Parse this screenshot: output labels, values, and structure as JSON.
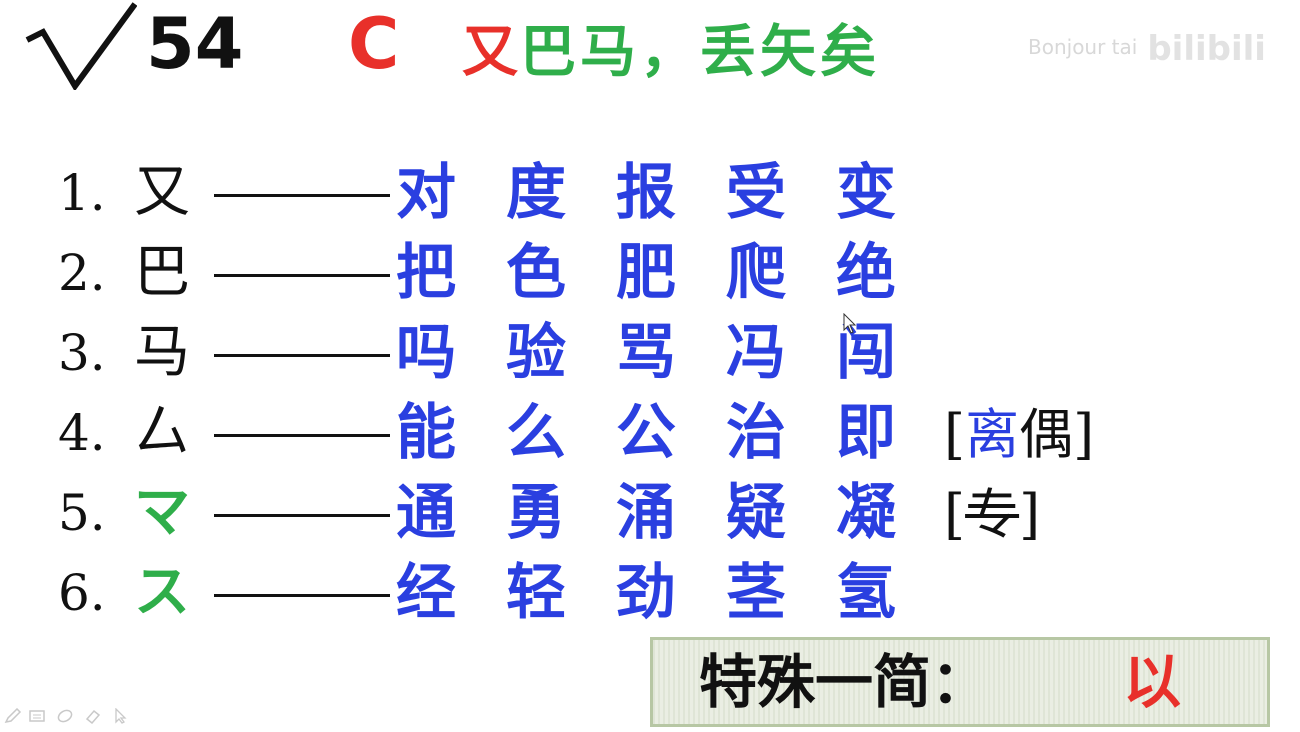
{
  "header": {
    "number": "54",
    "letter": "C",
    "component_red": "又",
    "components_green": "巴马，丢矢矣",
    "watermark_text": "Bonjour tai",
    "watermark_logo": "bilibili"
  },
  "rows": [
    {
      "num": "1.",
      "radical": "又",
      "radical_color": "black",
      "chars": [
        "对",
        "度",
        "报",
        "受",
        "变"
      ]
    },
    {
      "num": "2.",
      "radical": "巴",
      "radical_color": "black",
      "chars": [
        "把",
        "色",
        "肥",
        "爬",
        "绝"
      ]
    },
    {
      "num": "3.",
      "radical": "马",
      "radical_color": "black",
      "chars": [
        "吗",
        "验",
        "骂",
        "冯",
        "闯"
      ]
    },
    {
      "num": "4.",
      "radical": "厶",
      "radical_color": "black",
      "chars": [
        "能",
        "么",
        "公",
        "治",
        "即"
      ],
      "extra": {
        "open": "[",
        "blue": "离",
        "black": "偶",
        "close": "]"
      }
    },
    {
      "num": "5.",
      "radical": "マ",
      "radical_color": "green",
      "chars": [
        "通",
        "勇",
        "涌",
        "疑",
        "凝"
      ],
      "extra": {
        "open": "[",
        "strike": "专",
        "close": "]"
      }
    },
    {
      "num": "6.",
      "radical": "ス",
      "radical_color": "green",
      "chars": [
        "经",
        "轻",
        "劲",
        "茎",
        "氢"
      ]
    }
  ],
  "special": {
    "label": "特殊一简：",
    "value": "以"
  },
  "colors": {
    "blue": "#2a3fe0",
    "red": "#e8302a",
    "green": "#2fae4a"
  },
  "tools": [
    "pen-icon",
    "screen-icon",
    "highlighter-icon",
    "eraser-icon",
    "pointer-icon"
  ]
}
